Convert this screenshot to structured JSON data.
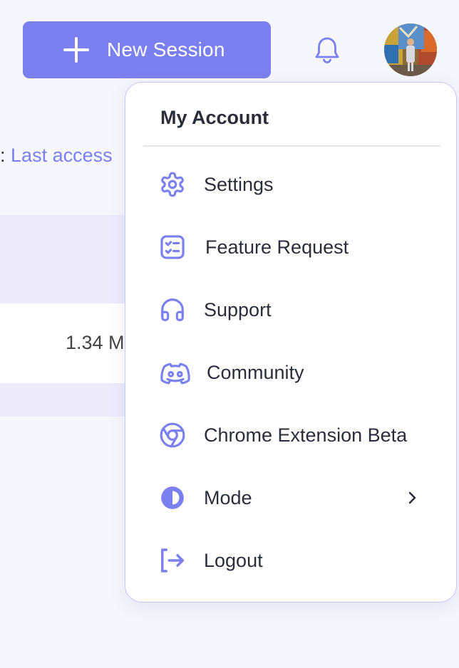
{
  "header": {
    "new_session_label": "New Session"
  },
  "background": {
    "sort_prefix": ":",
    "sort_link": "Last access",
    "row_size": "1.34 M"
  },
  "menu": {
    "title": "My Account",
    "items": [
      {
        "label": "Settings",
        "icon": "gear-icon"
      },
      {
        "label": "Feature Request",
        "icon": "checklist-icon"
      },
      {
        "label": "Support",
        "icon": "headphones-icon"
      },
      {
        "label": "Community",
        "icon": "discord-icon"
      },
      {
        "label": "Chrome Extension Beta",
        "icon": "chrome-icon"
      },
      {
        "label": "Mode",
        "icon": "contrast-icon"
      },
      {
        "label": "Logout",
        "icon": "logout-icon"
      }
    ]
  },
  "colors": {
    "accent": "#7b80f0",
    "background": "#f6f6fd",
    "menu_border": "#c6c8f5",
    "text": "#2b2e3a"
  }
}
